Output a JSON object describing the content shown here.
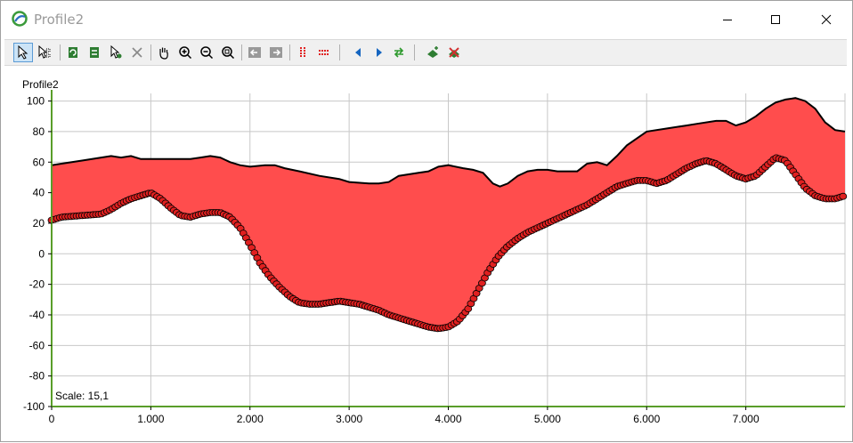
{
  "window": {
    "title": "Profile2",
    "minimize_label": "minimize",
    "maximize_label": "maximize",
    "close_label": "close"
  },
  "toolbar": {
    "buttons": [
      {
        "name": "select-arrow-icon",
        "active": true
      },
      {
        "name": "select-multi-icon",
        "active": false
      },
      {
        "name": "refresh-icon",
        "active": false
      },
      {
        "name": "refresh-alt-icon",
        "active": false
      },
      {
        "name": "edit-point-icon",
        "active": false
      },
      {
        "name": "delete-x-icon",
        "active": false
      },
      {
        "name": "pan-hand-icon",
        "active": false
      },
      {
        "name": "zoom-in-icon",
        "active": false
      },
      {
        "name": "zoom-out-icon",
        "active": false
      },
      {
        "name": "zoom-extent-icon",
        "active": false
      },
      {
        "name": "arrow-left-box-icon",
        "active": false
      },
      {
        "name": "arrow-right-box-icon",
        "active": false
      },
      {
        "name": "vertical-lines-icon",
        "active": false
      },
      {
        "name": "horizontal-lines-icon",
        "active": false
      },
      {
        "name": "triangle-left-icon",
        "active": false
      },
      {
        "name": "triangle-right-icon",
        "active": false
      },
      {
        "name": "swap-arrows-icon",
        "active": false
      },
      {
        "name": "add-layer-icon",
        "active": false
      },
      {
        "name": "remove-layer-icon",
        "active": false
      }
    ]
  },
  "chart_data": {
    "type": "area",
    "title": "Profile2",
    "scale_text": "Scale: 15,1",
    "xlim": [
      0,
      8000
    ],
    "ylim": [
      -100,
      105
    ],
    "x_ticks": [
      0,
      1000,
      2000,
      3000,
      4000,
      5000,
      6000,
      7000
    ],
    "x_tick_labels": [
      "0",
      "1.000",
      "2.000",
      "3.000",
      "4.000",
      "5.000",
      "6.000",
      "7.000"
    ],
    "y_ticks": [
      -100,
      -80,
      -60,
      -40,
      -20,
      0,
      20,
      40,
      60,
      80,
      100
    ],
    "y_tick_labels": [
      "-100",
      "-80",
      "-60",
      "-40",
      "-20",
      "0",
      "20",
      "40",
      "60",
      "80",
      "100"
    ],
    "grid": true,
    "colors": {
      "fill": "#ff4d4d",
      "upper_line": "#000000",
      "marker": "#e02020",
      "axis": "#5a9e2a"
    },
    "series": [
      {
        "role": "upper",
        "x": [
          0,
          100,
          300,
          500,
          600,
          700,
          800,
          900,
          1000,
          1200,
          1400,
          1500,
          1600,
          1700,
          1800,
          1900,
          2000,
          2150,
          2250,
          2350,
          2500,
          2700,
          2900,
          3000,
          3200,
          3300,
          3400,
          3500,
          3700,
          3800,
          3900,
          4000,
          4150,
          4250,
          4350,
          4450,
          4520,
          4600,
          4700,
          4800,
          4900,
          5000,
          5100,
          5200,
          5300,
          5400,
          5500,
          5600,
          5700,
          5800,
          6000,
          6200,
          6400,
          6500,
          6700,
          6800,
          6900,
          7000,
          7100,
          7200,
          7300,
          7400,
          7500,
          7600,
          7700,
          7800,
          7900,
          8000
        ],
        "y": [
          58,
          59,
          61,
          63,
          64,
          63,
          64,
          62,
          62,
          62,
          62,
          63,
          64,
          63,
          60,
          58,
          57,
          58,
          58,
          56,
          54,
          51,
          49,
          47,
          46,
          46,
          47,
          51,
          53,
          54,
          57,
          58,
          56,
          55,
          53,
          46,
          44,
          46,
          51,
          54,
          55,
          55,
          54,
          54,
          54,
          59,
          60,
          58,
          64,
          71,
          80,
          82,
          84,
          85,
          87,
          87,
          84,
          86,
          90,
          95,
          99,
          101,
          102,
          100,
          95,
          86,
          81,
          80
        ]
      },
      {
        "role": "lower",
        "x": [
          0,
          100,
          300,
          500,
          600,
          700,
          800,
          900,
          1000,
          1100,
          1200,
          1300,
          1400,
          1500,
          1600,
          1700,
          1800,
          1900,
          2000,
          2100,
          2200,
          2300,
          2400,
          2500,
          2600,
          2700,
          2800,
          2900,
          3000,
          3100,
          3200,
          3300,
          3400,
          3500,
          3600,
          3700,
          3800,
          3900,
          4000,
          4100,
          4200,
          4300,
          4400,
          4500,
          4600,
          4700,
          4800,
          4900,
          5000,
          5100,
          5200,
          5300,
          5400,
          5500,
          5600,
          5700,
          5800,
          5900,
          6000,
          6100,
          6200,
          6300,
          6400,
          6500,
          6600,
          6700,
          6800,
          6900,
          7000,
          7100,
          7200,
          7300,
          7400,
          7500,
          7600,
          7700,
          7800,
          7900,
          8000
        ],
        "y": [
          22,
          24,
          25,
          26,
          29,
          33,
          36,
          38,
          40,
          36,
          30,
          25,
          24,
          26,
          27,
          27,
          24,
          17,
          6,
          -6,
          -15,
          -22,
          -28,
          -32,
          -33,
          -33,
          -32,
          -31,
          -32,
          -33,
          -35,
          -37,
          -40,
          -42,
          -44,
          -46,
          -48,
          -49,
          -48,
          -44,
          -36,
          -24,
          -12,
          -2,
          5,
          10,
          14,
          17,
          20,
          23,
          26,
          29,
          32,
          36,
          40,
          44,
          46,
          48,
          48,
          46,
          48,
          52,
          56,
          59,
          61,
          59,
          55,
          51,
          49,
          51,
          57,
          63,
          61,
          52,
          43,
          38,
          36,
          36,
          38
        ]
      }
    ]
  }
}
